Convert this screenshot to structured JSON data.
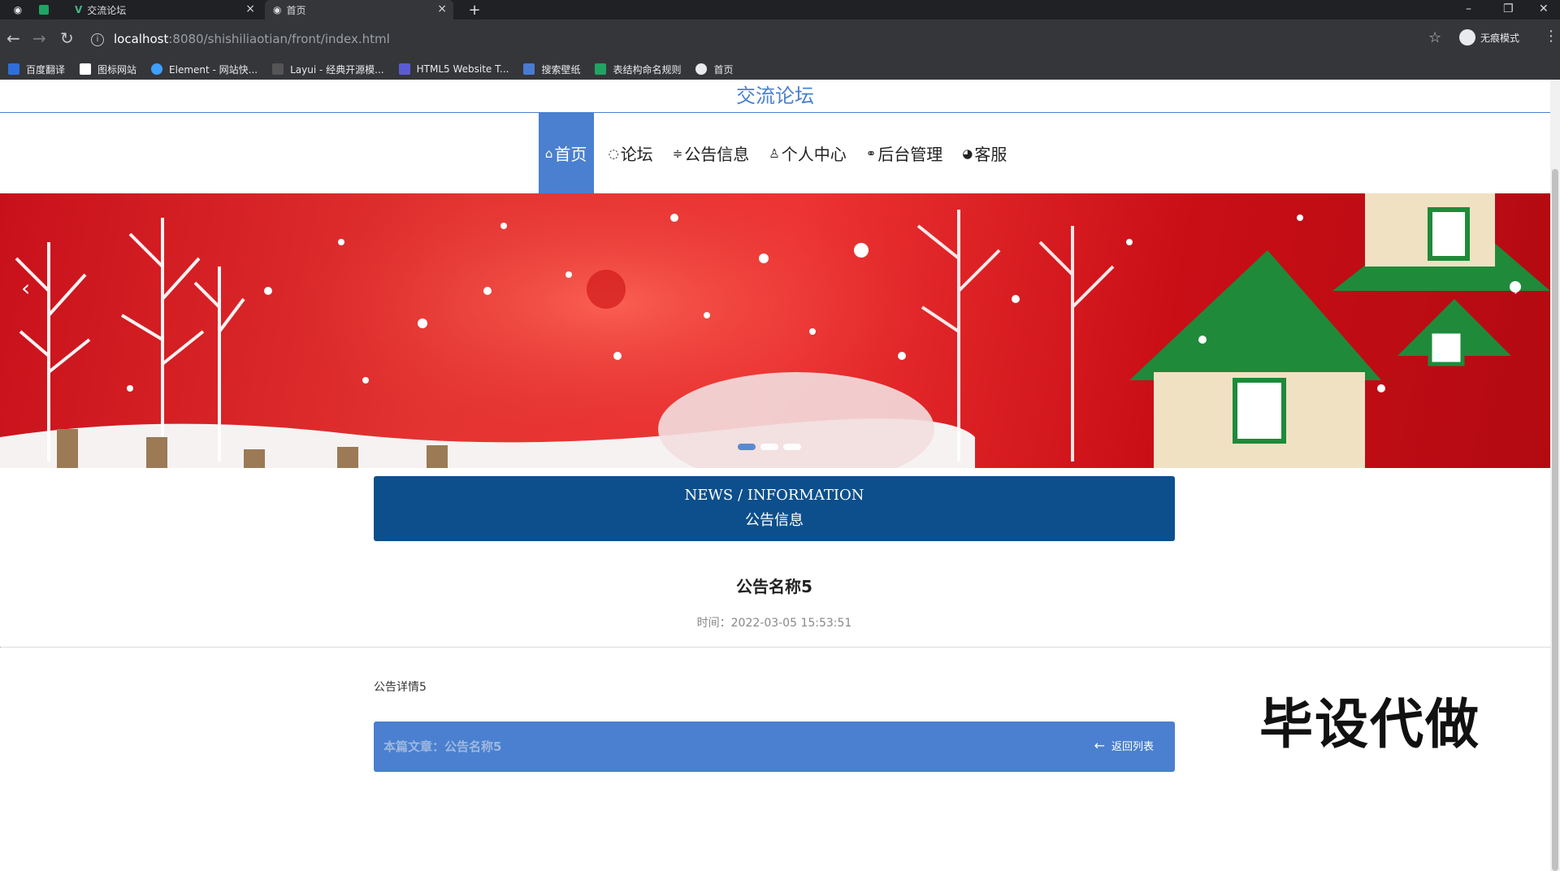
{
  "browser": {
    "tabs": [
      {
        "title": ""
      },
      {
        "title": ""
      },
      {
        "title": "交流论坛"
      },
      {
        "title": "首页"
      }
    ],
    "url_host": "localhost",
    "url_path": ":8080/shishiliaotian/front/index.html",
    "profile_label": "无痕模式",
    "bookmarks": [
      "百度翻译",
      "图标网站",
      "Element - 网站快...",
      "Layui - 经典开源模...",
      "HTML5 Website T...",
      "搜索壁纸",
      "表结构命名规则",
      "首页"
    ]
  },
  "site": {
    "title": "交流论坛",
    "nav": [
      {
        "icon": "⌂",
        "label": "首页"
      },
      {
        "icon": "◌",
        "label": "论坛"
      },
      {
        "icon": "≑",
        "label": "公告信息"
      },
      {
        "icon": "♙",
        "label": "个人中心"
      },
      {
        "icon": "⚭",
        "label": "后台管理"
      },
      {
        "icon": "◕",
        "label": "客服"
      }
    ]
  },
  "banner": {
    "prev": "‹",
    "next": "›",
    "slide_count": 3,
    "active_slide": 0
  },
  "news_header": {
    "en": "NEWS / INFORMATION",
    "cn": "公告信息"
  },
  "article": {
    "title": "公告名称5",
    "time": "时间：2022-03-05 15:53:51",
    "content": "公告详情5"
  },
  "footer_bar": {
    "current": "本篇文章：公告名称5",
    "back": "返回列表"
  },
  "watermark": "毕设代做",
  "colors": {
    "accent": "#4a80cf",
    "news_header": "#0c4f8c",
    "chrome": "#35363a"
  }
}
